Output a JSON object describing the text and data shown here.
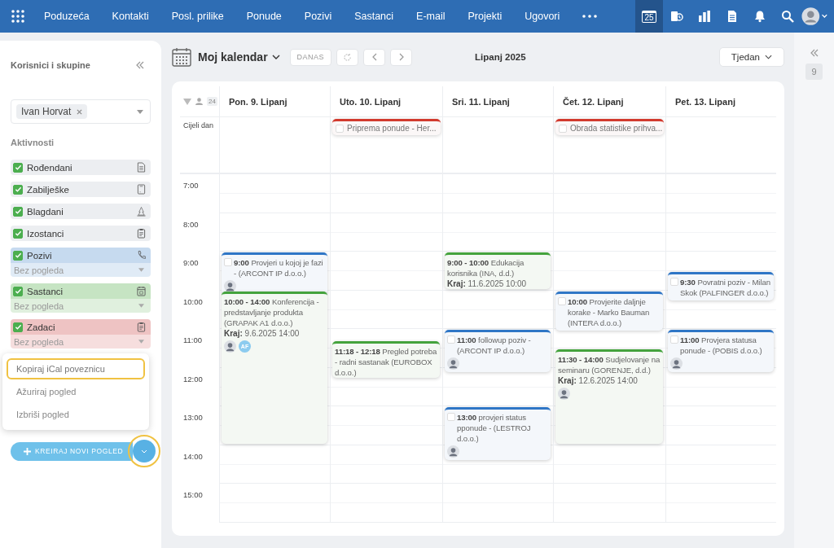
{
  "top_nav": {
    "items": [
      "Poduzeća",
      "Kontakti",
      "Posl. prilike",
      "Ponude",
      "Pozivi",
      "Sastanci",
      "E-mail",
      "Projekti",
      "Ugovori"
    ],
    "tools": [
      {
        "kind": "calendar",
        "label": "25",
        "selected": true
      },
      {
        "kind": "sync",
        "selected": false
      },
      {
        "kind": "chart",
        "selected": false
      },
      {
        "kind": "document",
        "selected": false
      },
      {
        "kind": "bell",
        "selected": false
      },
      {
        "kind": "search",
        "selected": false
      },
      {
        "kind": "avatar",
        "selected": false
      }
    ]
  },
  "sidebar": {
    "title": "Korisnici i skupine",
    "user_chip": "Ivan Horvat",
    "activities_title": "Aktivnosti",
    "activities": [
      {
        "label": "Rođendani",
        "checked": true,
        "color": "#eceef1"
      },
      {
        "label": "Zabilješke",
        "checked": true,
        "color": "#eceef1"
      },
      {
        "label": "Blagdani",
        "checked": true,
        "color": "#eceef1"
      },
      {
        "label": "Izostanci",
        "checked": true,
        "color": "#eceef1"
      },
      {
        "label": "Pozivi",
        "checked": true,
        "color": "#c6daef",
        "view": "Bez pogleda"
      },
      {
        "label": "Sastanci",
        "checked": true,
        "color": "#c6e4c3",
        "view": "Bez pogleda"
      },
      {
        "label": "Zadaci",
        "checked": true,
        "color": "#eec3c3",
        "view": "Bez pogleda"
      }
    ],
    "menu": [
      {
        "label": "Kopiraj iCal poveznicu",
        "selected": true
      },
      {
        "label": "Ažuriraj pogled",
        "selected": false
      },
      {
        "label": "Izbriši pogled",
        "selected": false
      }
    ],
    "create_button": {
      "label": "KREIRAJ NOVI POGLED",
      "toggle_highlighted": true
    }
  },
  "calendar": {
    "title": "Moj kalendar",
    "today": "DANAS",
    "period": "Lipanj 2025",
    "view": "Tjedan",
    "people_count": "24",
    "all_day_label": "Cijeli dan",
    "hours": [
      "7:00",
      "8:00",
      "9:00",
      "10:00",
      "11:00",
      "12:00",
      "13:00",
      "14:00",
      "15:00"
    ],
    "days": [
      {
        "label": "Pon. 9. Lipanj",
        "events": [
          {
            "kind": "call",
            "time": "9:00",
            "text": "Provjeri u kojoj je fazi - (ARCONT IP d.o.o.)",
            "checked": false,
            "avatars": [
              {
                "kind": "photo"
              }
            ]
          },
          {
            "kind": "meeting",
            "time": "10:00 - 14:00",
            "text": "Konferencija - predstavljanje produkta (GRAPAK A1 d.o.o.)",
            "end": "**Kraj:** 9.6.2025 14:00",
            "avatars": [
              {
                "kind": "photo"
              },
              {
                "kind": "initials",
                "text": "AF"
              }
            ]
          }
        ]
      },
      {
        "label": "Uto. 10. Lipanj",
        "all_day": [
          {
            "kind": "todo",
            "text": "Priprema ponude - Her...",
            "checked": false
          }
        ],
        "events": [
          {
            "kind": "meeting",
            "time": "11:18 - 12:18",
            "text": "Pregled potreba - radni sastanak (EUROBOX d.o.o.)"
          }
        ]
      },
      {
        "label": "Sri. 11. Lipanj",
        "events": [
          {
            "kind": "meeting",
            "time": "9:00 - 10:00",
            "text": "Edukacija korisnika (INA, d.d.)",
            "end": "**Kraj:** 11.6.2025 10:00"
          },
          {
            "kind": "call",
            "time": "11:00",
            "text": "followup poziv - (ARCONT IP d.o.o.)",
            "checked": false,
            "avatars": [
              {
                "kind": "photo"
              }
            ]
          },
          {
            "kind": "call",
            "time": "13:00",
            "text": "provjeri status pponude - (LESTROJ d.o.o.)",
            "checked": false,
            "avatars": [
              {
                "kind": "photo"
              }
            ]
          }
        ]
      },
      {
        "label": "Čet. 12. Lipanj",
        "all_day": [
          {
            "kind": "todo",
            "text": "Obrada statistike prihva...",
            "checked": false
          }
        ],
        "events": [
          {
            "kind": "call",
            "time": "10:00",
            "text": "Provjerite daljnje korake - Marko Bauman (INTERA d.o.o.)",
            "checked": false
          },
          {
            "kind": "meeting",
            "time": "11:30 - 14:00",
            "text": "Sudjelovanje na seminaru (GORENJE, d.d.)",
            "end": "**Kraj:** 12.6.2025 14:00",
            "avatars": [
              {
                "kind": "photo"
              }
            ]
          }
        ]
      },
      {
        "label": "Pet. 13. Lipanj",
        "events": [
          {
            "kind": "call",
            "time": "9:30",
            "text": "Povratni poziv - Milan Skok (PALFINGER d.o.o.)",
            "checked": false
          },
          {
            "kind": "call",
            "time": "11:00",
            "text": "Provjera statusa ponude - (POBIS d.o.o.)",
            "checked": false,
            "avatars": [
              {
                "kind": "photo"
              }
            ]
          }
        ]
      }
    ]
  },
  "right_rail": {
    "badge": "9"
  }
}
